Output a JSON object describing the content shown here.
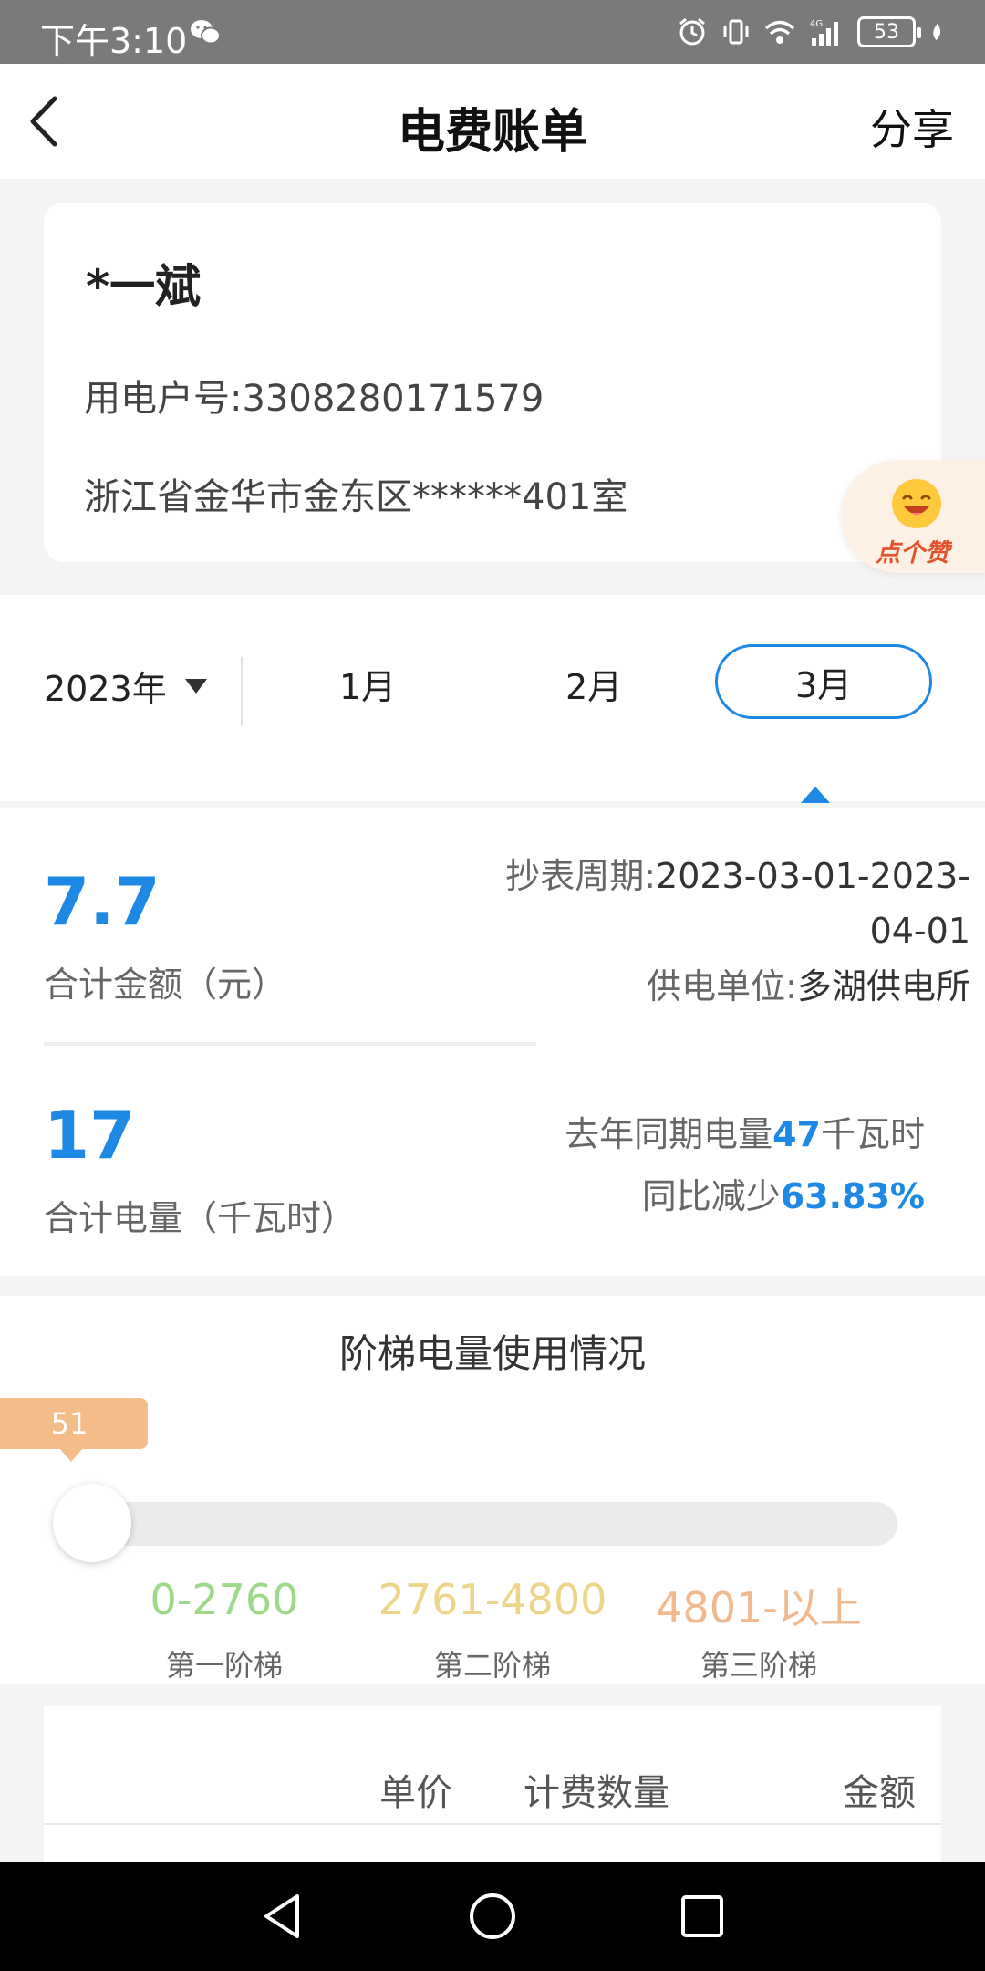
{
  "status_bar": {
    "time": "下午3:10",
    "battery": "53",
    "network": "4G"
  },
  "nav": {
    "title": "电费账单",
    "share": "分享"
  },
  "user": {
    "name": "*一斌",
    "account": "用电户号:3308280171579",
    "address": "浙江省金华市金东区******401室"
  },
  "like_button": {
    "label": "点个赞"
  },
  "months": {
    "year": "2023年",
    "items": [
      "1月",
      "2月",
      "3月"
    ],
    "selected": "3月"
  },
  "summary": {
    "amount": "7.7",
    "amount_label": "合计金额（元）",
    "period_key": "抄表周期:",
    "period_value": "2023-03-01-2023-04-01",
    "supplier_key": "供电单位:",
    "supplier_value": "多湖供电所",
    "kwh": "17",
    "kwh_label": "合计电量（千瓦时）",
    "last_year_prefix": "去年同期电量",
    "last_year_value": "47",
    "last_year_unit": "千瓦时",
    "yoy_prefix": "同比减少",
    "yoy_value": "63.83%"
  },
  "tier": {
    "title": "阶梯电量使用情况",
    "current_value": "51",
    "fill_fraction": 0.0,
    "ranges": [
      {
        "range": "0-2760",
        "label": "第一阶梯",
        "color": "#9ed98a"
      },
      {
        "range": "2761-4800",
        "label": "第二阶梯",
        "color": "#ecd58a"
      },
      {
        "range": "4801-以上",
        "label": "第三阶梯",
        "color": "#f2b98e"
      }
    ]
  },
  "table": {
    "headers": [
      "单价",
      "计费数量",
      "金额"
    ]
  },
  "colors": {
    "accent": "#1e88e5",
    "bubble": "#f4bd89"
  }
}
